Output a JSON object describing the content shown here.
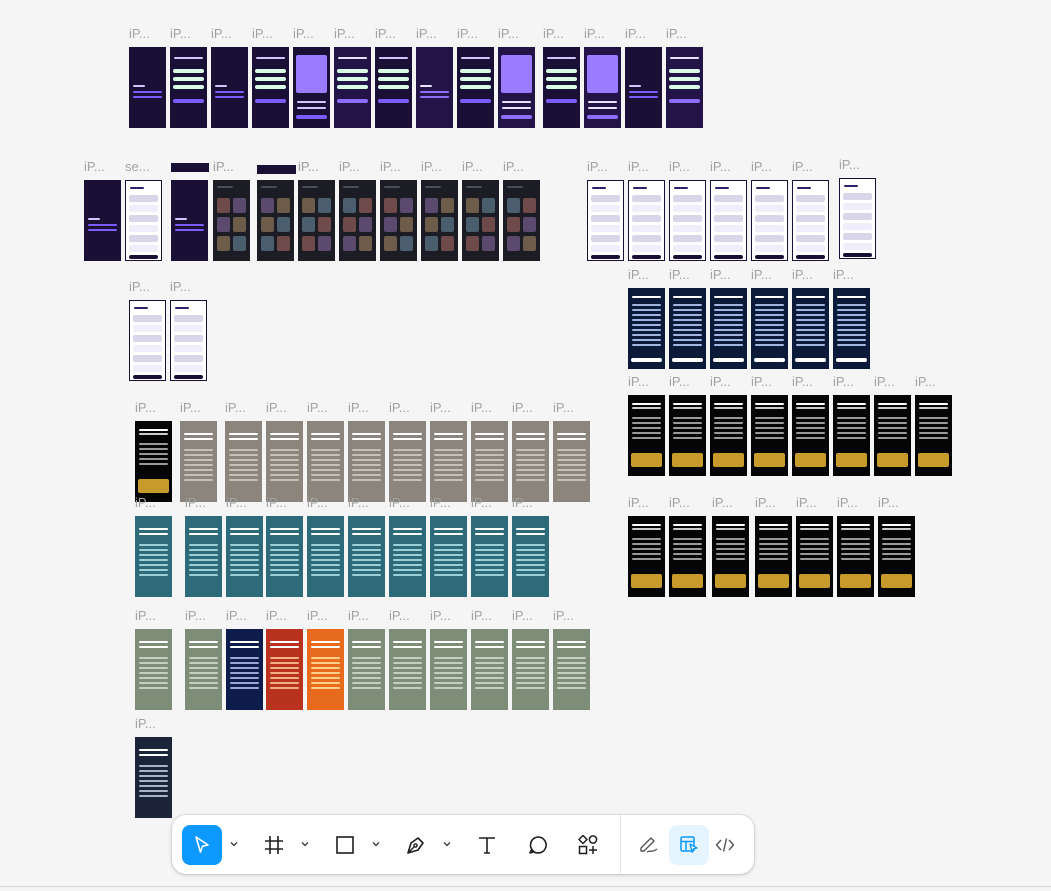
{
  "canvas": {
    "labels": {
      "ip": "iP...",
      "se": "se..."
    }
  },
  "toolbar": {
    "tools": [
      {
        "name": "move-tool",
        "icon": "cursor-arrow-icon",
        "active": true
      },
      {
        "name": "frame-tool",
        "icon": "hash-frame-icon",
        "active": false
      },
      {
        "name": "shape-tool",
        "icon": "rectangle-icon",
        "active": false
      },
      {
        "name": "pen-tool",
        "icon": "pen-nib-icon",
        "active": false
      },
      {
        "name": "text-tool",
        "icon": "text-t-icon",
        "active": false
      },
      {
        "name": "comment-tool",
        "icon": "speech-bubble-icon",
        "active": false
      },
      {
        "name": "actions-tool",
        "icon": "components-plus-icon",
        "active": false
      },
      {
        "name": "draw-mode",
        "icon": "scribble-icon",
        "active": false
      },
      {
        "name": "design-mode",
        "icon": "design-mode-icon",
        "active": true
      },
      {
        "name": "dev-mode",
        "icon": "code-brackets-icon",
        "active": false
      }
    ],
    "accent_color": "#0d99ff",
    "active_bg": "#e5f4ff"
  }
}
